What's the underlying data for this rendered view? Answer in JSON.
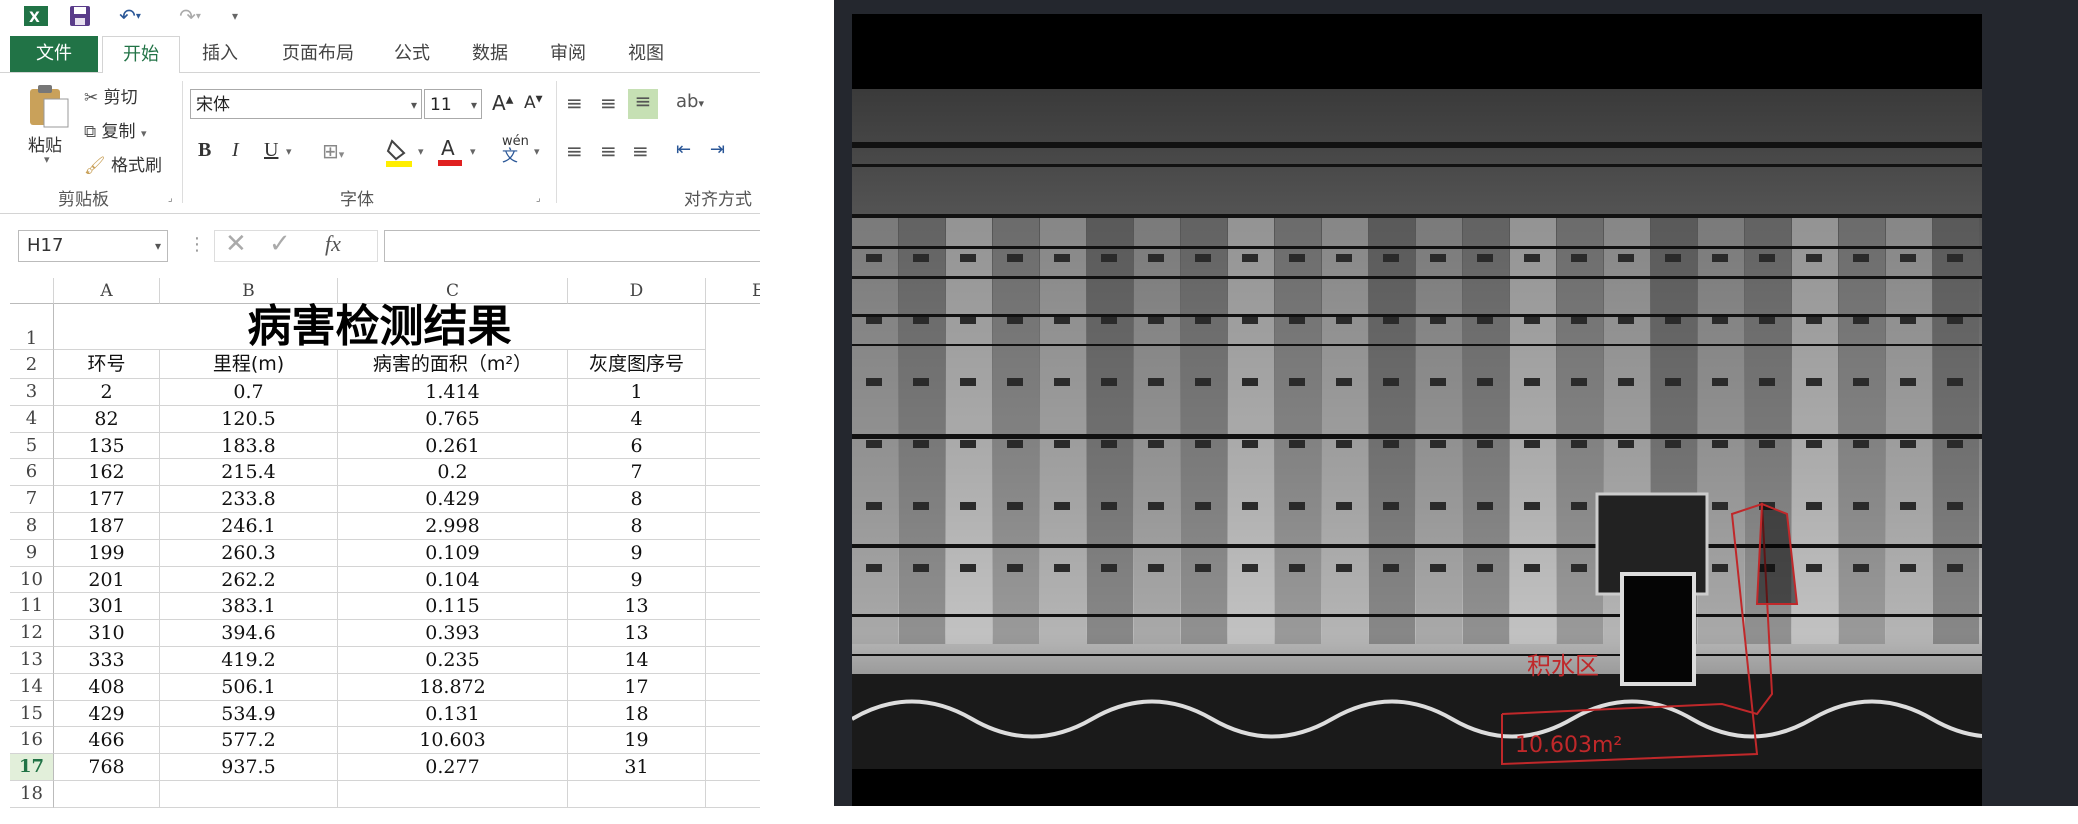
{
  "excel": {
    "qat": {
      "app_icon": "excel-logo-icon",
      "save_icon": "save-icon",
      "undo_icon": "undo-icon",
      "redo_icon": "redo-icon",
      "customize_icon": "customize-qat-icon"
    },
    "tabs": [
      "文件",
      "开始",
      "插入",
      "页面布局",
      "公式",
      "数据",
      "审阅",
      "视图"
    ],
    "ribbon": {
      "paste": "粘贴",
      "cut": "剪切",
      "copy": "复制",
      "format_painter": "格式刷",
      "font_name": "宋体",
      "font_size": "11",
      "bold": "B",
      "italic": "I",
      "underline": "U",
      "phonetic": "wén",
      "groups": {
        "clipboard": "剪贴板",
        "font": "字体",
        "alignment": "对齐方式"
      }
    },
    "formula_bar": {
      "name_box": "H17",
      "fx": "fx",
      "formula": ""
    },
    "columns": [
      "A",
      "B",
      "C",
      "D",
      "E"
    ],
    "title": "病害检测结果",
    "headers": [
      "环号",
      "里程(m)",
      "病害的面积（m²）",
      "灰度图序号"
    ],
    "row_numbers": [
      "1",
      "2",
      "3",
      "4",
      "5",
      "6",
      "7",
      "8",
      "9",
      "10",
      "11",
      "12",
      "13",
      "14",
      "15",
      "16",
      "17",
      "18"
    ],
    "rows": [
      [
        "2",
        "0.7",
        "1.414",
        "1"
      ],
      [
        "82",
        "120.5",
        "0.765",
        "4"
      ],
      [
        "135",
        "183.8",
        "0.261",
        "6"
      ],
      [
        "162",
        "215.4",
        "0.2",
        "7"
      ],
      [
        "177",
        "233.8",
        "0.429",
        "8"
      ],
      [
        "187",
        "246.1",
        "2.998",
        "8"
      ],
      [
        "199",
        "260.3",
        "0.109",
        "9"
      ],
      [
        "201",
        "262.2",
        "0.104",
        "9"
      ],
      [
        "301",
        "383.1",
        "0.115",
        "13"
      ],
      [
        "310",
        "394.6",
        "0.393",
        "13"
      ],
      [
        "333",
        "419.2",
        "0.235",
        "14"
      ],
      [
        "408",
        "506.1",
        "18.872",
        "17"
      ],
      [
        "429",
        "534.9",
        "0.131",
        "18"
      ],
      [
        "466",
        "577.2",
        "10.603",
        "19"
      ],
      [
        "768",
        "937.5",
        "0.277",
        "31"
      ]
    ],
    "active_row": "17",
    "colors": {
      "accent": "#217346",
      "font_color": "#e02020",
      "highlight": "#ffee00"
    }
  },
  "viewer": {
    "annotation_label": "积水区",
    "annotation_area": "10.603m²",
    "colors": {
      "annotation": "#c0282a",
      "background": "#24272e"
    }
  }
}
